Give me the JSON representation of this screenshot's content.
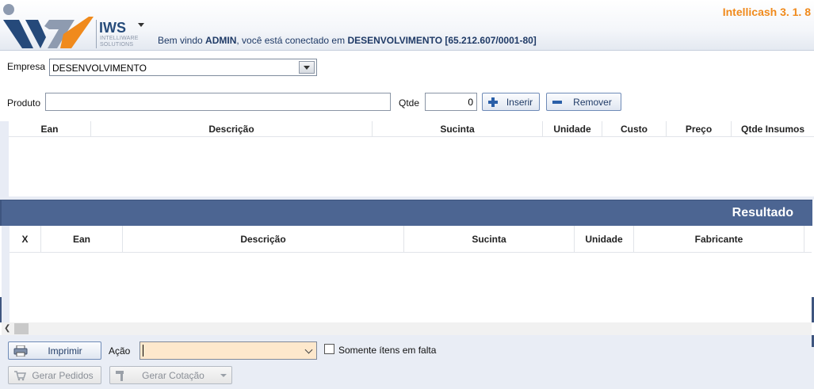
{
  "header": {
    "logo_text": "IWS",
    "logo_sub_1": "INTELLIWARE",
    "logo_sub_2": "SOLUTIONS",
    "welcome_prefix": "Bem vindo ",
    "user": "ADMIN",
    "welcome_mid": ", você está conectado em ",
    "company": "DESENVOLVIMENTO [65.212.607/0001-80]",
    "version": "Intellicash 3. 1.  8"
  },
  "form": {
    "empresa_label": "Empresa",
    "empresa_value": "DESENVOLVIMENTO",
    "produto_label": "Produto",
    "produto_value": "",
    "qtde_label": "Qtde",
    "qtde_value": "0",
    "inserir_label": "Inserir",
    "remover_label": "Remover"
  },
  "insumos_table": {
    "columns": [
      "Ean",
      "Descrição",
      "Sucinta",
      "Unidade",
      "Custo",
      "Preço",
      "Qtde Insumos"
    ]
  },
  "resultado": {
    "title": "Resultado",
    "columns": [
      "X",
      "Ean",
      "Descrição",
      "Sucinta",
      "Unidade",
      "Fabricante"
    ]
  },
  "footer": {
    "imprimir_label": "Imprimir",
    "acao_label": "Ação",
    "acao_value": "",
    "somente_label": "Somente ítens em falta",
    "somente_checked": false,
    "gerar_pedidos_label": "Gerar Pedidos",
    "gerar_cotacao_label": "Gerar Cotação"
  },
  "colors": {
    "accent": "#f08a1c",
    "brand_blue": "#264b7a",
    "result_bar": "#4c6592",
    "acao_bg": "#fde8cc"
  }
}
